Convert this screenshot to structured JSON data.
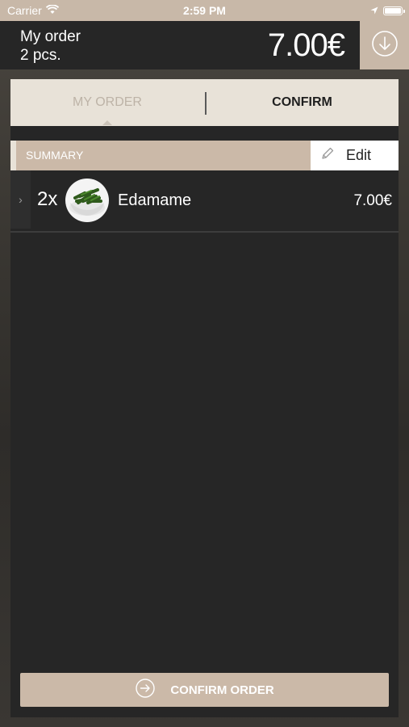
{
  "status_bar": {
    "carrier": "Carrier",
    "time": "2:59 PM",
    "icons": [
      "wifi-icon",
      "location-icon",
      "battery-icon"
    ]
  },
  "header": {
    "title": "My order",
    "count": "2 pcs.",
    "total": "7.00€",
    "action_icon": "download-circle-icon"
  },
  "tabs": [
    {
      "label": "MY ORDER",
      "active": true
    },
    {
      "label": "CONFIRM",
      "active": false
    }
  ],
  "summary": {
    "label": "SUMMARY",
    "edit_label": "Edit",
    "edit_icon": "pencil-icon"
  },
  "items": [
    {
      "quantity": "2x",
      "name": "Edamame",
      "price": "7.00€",
      "thumbnail": "edamame-bowl"
    }
  ],
  "confirm_button": {
    "label": "CONFIRM ORDER",
    "icon": "arrow-right-circle-icon"
  },
  "colors": {
    "accent": "#c8b8a8",
    "tab_bg": "#e8e2d8",
    "panel_bg": "#262626"
  }
}
